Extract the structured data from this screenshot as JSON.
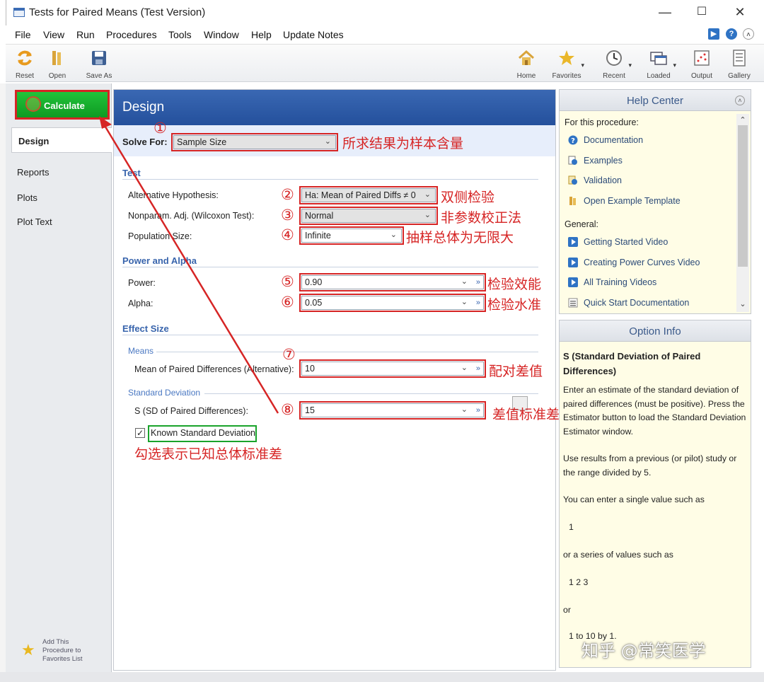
{
  "window": {
    "title": "Tests for Paired Means (Test Version)"
  },
  "menu": [
    "File",
    "View",
    "Run",
    "Procedures",
    "Tools",
    "Window",
    "Help",
    "Update Notes"
  ],
  "toolbar": {
    "reset": "Reset",
    "open": "Open",
    "save_as": "Save As",
    "home": "Home",
    "favorites": "Favorites",
    "recent": "Recent",
    "loaded": "Loaded",
    "output": "Output",
    "gallery": "Gallery"
  },
  "nav": {
    "calculate": "Calculate",
    "design": "Design",
    "reports": "Reports",
    "plots": "Plots",
    "plot_text": "Plot Text",
    "add_favorites": "Add This Procedure to Favorites List"
  },
  "design": {
    "header": "Design",
    "solve_for_label": "Solve For:",
    "solve_for_value": "Sample Size",
    "sections": {
      "test": "Test",
      "power_alpha": "Power and Alpha",
      "effect_size": "Effect Size",
      "means": "Means",
      "std_dev": "Standard Deviation"
    },
    "fields": {
      "alt_hyp_label": "Alternative Hypothesis:",
      "alt_hyp_value": "Ha: Mean of Paired Diffs ≠ 0",
      "nonparam_label": "Nonparam. Adj. (Wilcoxon Test):",
      "nonparam_value": "Normal",
      "pop_size_label": "Population Size:",
      "pop_size_value": "Infinite",
      "power_label": "Power:",
      "power_value": "0.90",
      "alpha_label": "Alpha:",
      "alpha_value": "0.05",
      "mean_diff_label": "Mean of Paired Differences (Alternative):",
      "mean_diff_value": "10",
      "sd_label": "S (SD of Paired Differences):",
      "sd_value": "15",
      "known_sd_label": "Known Standard Deviation",
      "known_sd_checked": true
    }
  },
  "annotations": {
    "n1": "①",
    "n2": "②",
    "n3": "③",
    "n4": "④",
    "n5": "⑤",
    "n6": "⑥",
    "n7": "⑦",
    "n8": "⑧",
    "a1": "所求结果为样本含量",
    "a2": "双侧检验",
    "a3": "非参数校正法",
    "a4": "抽样总体为无限大",
    "a5": "检验效能",
    "a6": "检验水准",
    "a7": "配对差值",
    "a8": "差值标准差",
    "a9": "勾选表示已知总体标准差",
    "red": "#d62525",
    "green": "#19a32b"
  },
  "help_center": {
    "title": "Help Center",
    "for_procedure": "For this procedure:",
    "links1": [
      "Documentation",
      "Examples",
      "Validation",
      "Open Example Template"
    ],
    "general": "General:",
    "links2": [
      "Getting Started Video",
      "Creating Power Curves Video",
      "All Training Videos",
      "Quick Start Documentation"
    ]
  },
  "option_info": {
    "title": "Option Info",
    "heading": "S (Standard Deviation of Paired Differences)",
    "p1": "Enter an estimate of the standard deviation of paired differences (must be positive). Press the Estimator button to load the Standard Deviation Estimator window.",
    "p2": "Use results from a previous (or pilot) study or the range divided by 5.",
    "p3": "You can enter a single value such as",
    "ex1": "1",
    "p4": "or a series of values such as",
    "ex2": "1 2 3",
    "p5": "or",
    "ex3": "1 to 10 by 1."
  },
  "watermark": "知乎 @常笑医学"
}
